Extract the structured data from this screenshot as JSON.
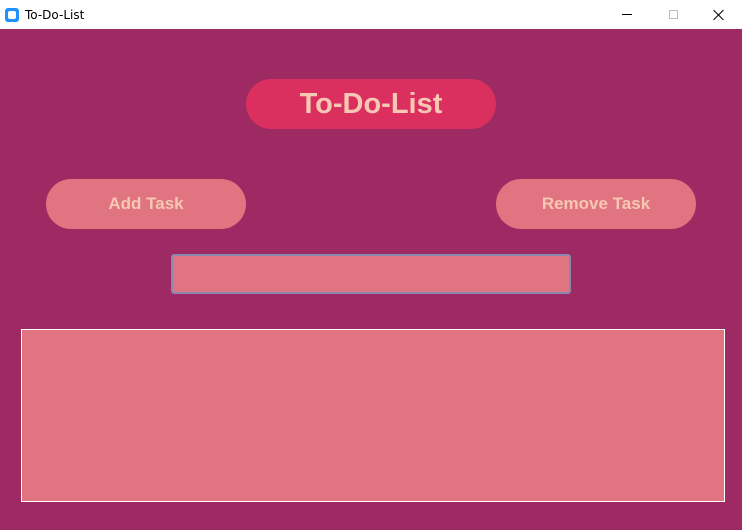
{
  "window": {
    "title": "To-Do-List",
    "icon": "app-icon"
  },
  "main": {
    "heading": "To-Do-List",
    "add_button_label": "Add Task",
    "remove_button_label": "Remove Task",
    "task_input_value": "",
    "tasks": []
  },
  "colors": {
    "background": "#9e2a63",
    "heading_bg": "#db2f60",
    "button_bg": "#e07480",
    "text": "#f6c8b4"
  }
}
